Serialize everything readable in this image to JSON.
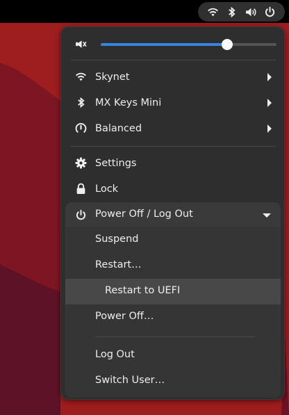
{
  "colors": {
    "accent": "#3584e4",
    "wallpaper_red": "#9e1d1f",
    "wallpaper_dark": "#6b1224"
  },
  "topbar": {
    "tray_icons": [
      "wifi-icon",
      "bluetooth-icon",
      "volume-icon",
      "power-icon"
    ]
  },
  "volume": {
    "icon": "volume-muted-icon",
    "level": 0.72
  },
  "quick": [
    {
      "icon": "wifi-icon",
      "label": "Skynet",
      "has_submenu": true
    },
    {
      "icon": "bluetooth-icon",
      "label": "MX Keys Mini",
      "has_submenu": true
    },
    {
      "icon": "power-profile-icon",
      "label": "Balanced",
      "has_submenu": true
    }
  ],
  "actions": [
    {
      "icon": "gear-icon",
      "label": "Settings"
    },
    {
      "icon": "lock-icon",
      "label": "Lock"
    }
  ],
  "power": {
    "icon": "power-icon",
    "label": "Power Off / Log Out",
    "expanded": true,
    "items": [
      {
        "label": "Suspend"
      },
      {
        "label": "Restart…"
      },
      {
        "label": "Restart to UEFI",
        "nested": true,
        "highlighted": true
      },
      {
        "label": "Power Off…"
      },
      {
        "label": "Log Out"
      },
      {
        "label": "Switch User…"
      }
    ]
  }
}
